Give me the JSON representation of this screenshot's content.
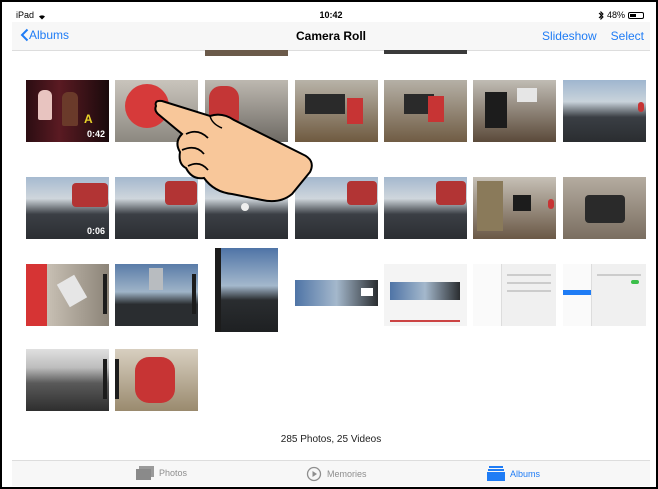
{
  "status": {
    "device": "iPad",
    "time": "10:42",
    "battery": "48%",
    "battery_level": 0.48
  },
  "nav": {
    "back_label": "Albums",
    "title": "Camera Roll",
    "slideshow_label": "Slideshow",
    "select_label": "Select"
  },
  "thumbs": {
    "r1c1_duration": "0:42",
    "r2c1_duration": "0:06"
  },
  "summary": "285 Photos, 25 Videos",
  "tabs": {
    "photos": "Photos",
    "memories": "Memories",
    "albums": "Albums"
  },
  "colors": {
    "accent": "#1f7cf5"
  }
}
